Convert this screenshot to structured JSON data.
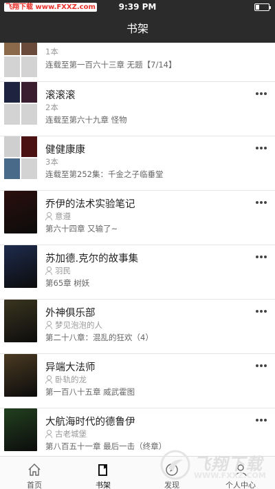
{
  "status_bar": {
    "watermark": "飞翔下载 www.FXXZ.com",
    "time": "9:39 PM"
  },
  "nav": {
    "title": "书架"
  },
  "groups": [
    {
      "count": "1本",
      "latest": "连载至第一百六十三章 无题【7/14】"
    },
    {
      "name": "滚滚滚",
      "count": "2本",
      "latest": "连载至第六十九章 怪物"
    },
    {
      "name": "健健康康",
      "count": "3本",
      "latest": "连载至第252集：千金之子临垂堂"
    }
  ],
  "books": [
    {
      "title": "乔伊的法术实验笔记",
      "author": "意遵",
      "latest": "第六十四章 又输了~",
      "cover_color": "#2a0f0d"
    },
    {
      "title": "苏加德.克尔的故事集",
      "author": "羽民",
      "latest": "第65章 树妖",
      "cover_color": "#1e2b4d"
    },
    {
      "title": "外神俱乐部",
      "author": "梦见泡泡的人",
      "latest": "第二十八章：混乱的狂欢（4）",
      "cover_color": "#3a3520"
    },
    {
      "title": "异端大法师",
      "author": "卧轨的龙",
      "latest": "第一百八十五章 威武霍图",
      "cover_color": "#4a3a22"
    },
    {
      "title": "大航海时代的德鲁伊",
      "author": "古老城堡",
      "latest": "第八百五十一章 最后一击（终章）",
      "cover_color": "#22401f"
    }
  ],
  "tabs": [
    {
      "label": "首页",
      "icon": "home-icon"
    },
    {
      "label": "书架",
      "icon": "bookshelf-icon"
    },
    {
      "label": "发现",
      "icon": "discover-icon"
    },
    {
      "label": "个人中心",
      "icon": "profile-icon"
    }
  ],
  "watermark": {
    "main": "飞翔下载",
    "url": "WWW.FXXZ.COM"
  }
}
